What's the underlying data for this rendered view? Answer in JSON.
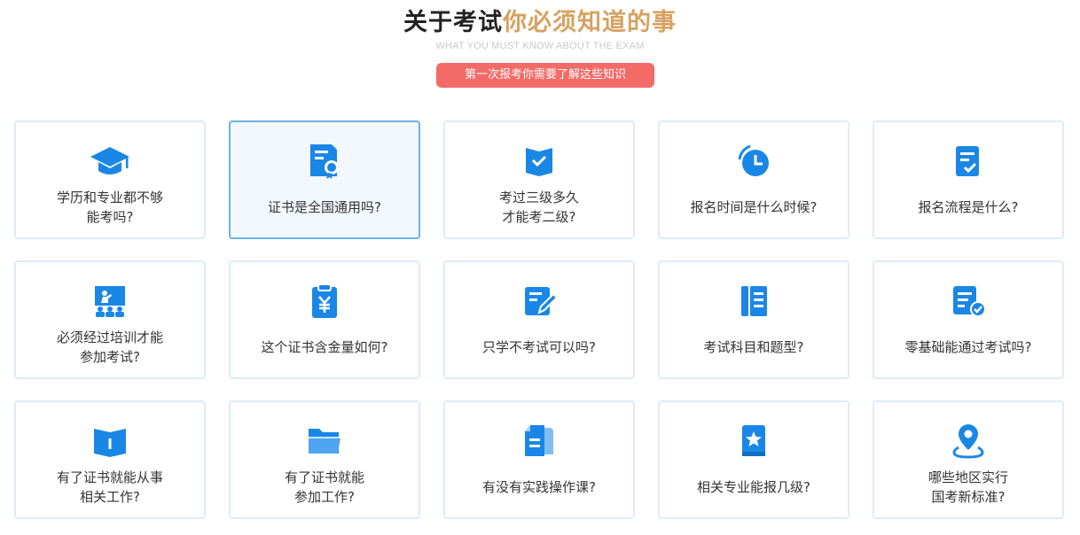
{
  "header": {
    "title_part1": "关于考试",
    "title_part2": "你必须知道的事",
    "subtitle": "WHAT YOU MUST KNOW ABOUT THE EXAM",
    "pill_label": "第一次报考你需要了解这些知识"
  },
  "colors": {
    "title_dark": "#222222",
    "title_gold": "#d7a160",
    "pill_bg": "#f26b67",
    "icon_blue": "#1a87e6",
    "card_border": "#dcedf7",
    "card_active_border": "#6cb2ea",
    "card_active_bg": "#f3f8fe"
  },
  "cards": [
    {
      "label": "学历和专业都不够\n能考吗?",
      "icon": "graduation-cap-icon"
    },
    {
      "label": "证书是全国通用吗?",
      "icon": "certificate-icon",
      "active": true
    },
    {
      "label": "考过三级多久\n才能考二级?",
      "icon": "book-check-icon"
    },
    {
      "label": "报名时间是什么时候?",
      "icon": "clock-icon"
    },
    {
      "label": "报名流程是什么?",
      "icon": "checklist-icon"
    },
    {
      "label": "必须经过培训才能\n参加考试?",
      "icon": "classroom-icon"
    },
    {
      "label": "这个证书含金量如何?",
      "icon": "clipboard-yen-icon"
    },
    {
      "label": "只学不考试可以吗?",
      "icon": "edit-document-icon"
    },
    {
      "label": "考试科目和题型?",
      "icon": "notebook-icon"
    },
    {
      "label": "零基础能通过考试吗?",
      "icon": "document-check-icon"
    },
    {
      "label": "有了证书就能从事\n相关工作?",
      "icon": "open-book-icon"
    },
    {
      "label": "有了证书就能\n参加工作?",
      "icon": "folder-icon"
    },
    {
      "label": "有没有实践操作课?",
      "icon": "documents-icon"
    },
    {
      "label": "相关专业能报几级?",
      "icon": "star-book-icon"
    },
    {
      "label": "哪些地区实行\n国考新标准?",
      "icon": "location-pin-icon"
    }
  ]
}
